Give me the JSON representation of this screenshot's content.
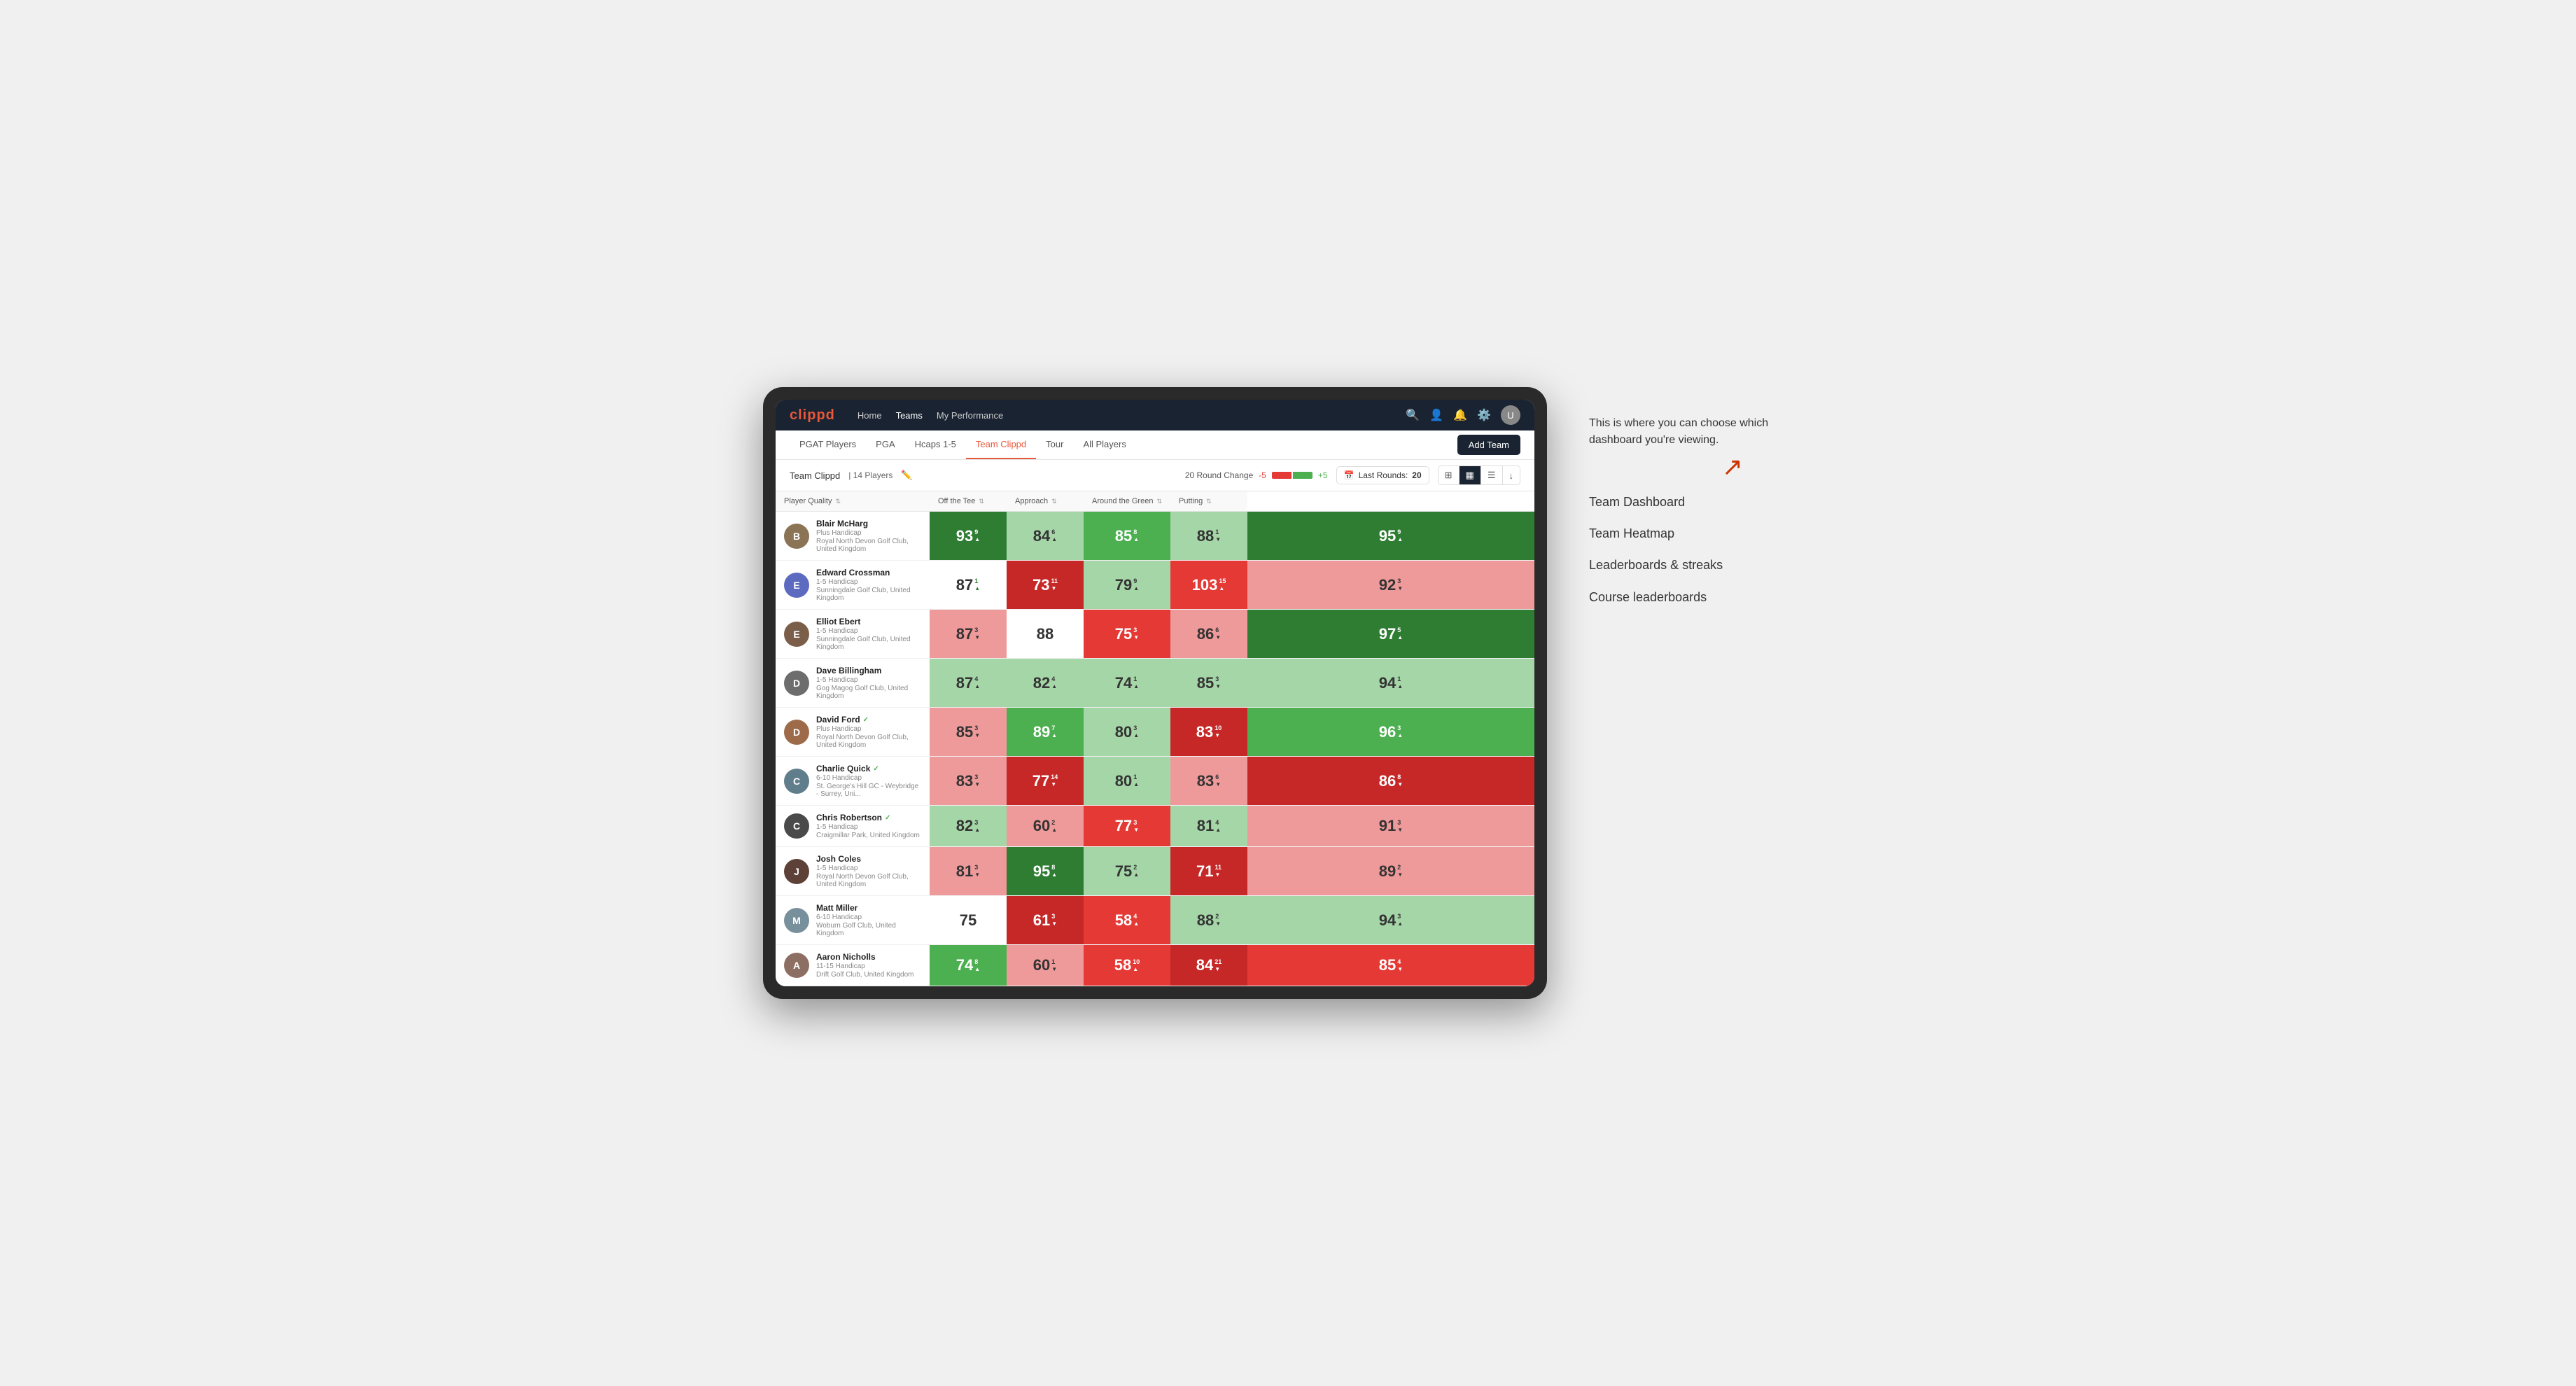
{
  "annotation": {
    "intro": "This is where you can choose which dashboard you're viewing.",
    "options": [
      "Team Dashboard",
      "Team Heatmap",
      "Leaderboards & streaks",
      "Course leaderboards"
    ]
  },
  "nav": {
    "logo": "clippd",
    "links": [
      "Home",
      "Teams",
      "My Performance"
    ],
    "active_link": "Teams"
  },
  "sub_nav": {
    "links": [
      "PGAT Players",
      "PGA",
      "Hcaps 1-5",
      "Team Clippd",
      "Tour",
      "All Players"
    ],
    "active_link": "Team Clippd",
    "add_team_label": "Add Team"
  },
  "team_bar": {
    "name": "Team Clippd",
    "separator": "|",
    "count": "14 Players",
    "round_change_label": "20 Round Change",
    "change_neg": "-5",
    "change_pos": "+5",
    "last_rounds_label": "Last Rounds:",
    "last_rounds_value": "20"
  },
  "table": {
    "columns": [
      {
        "key": "player",
        "label": "Player Quality"
      },
      {
        "key": "off_tee",
        "label": "Off the Tee"
      },
      {
        "key": "approach",
        "label": "Approach"
      },
      {
        "key": "around_green",
        "label": "Around the Green"
      },
      {
        "key": "putting",
        "label": "Putting"
      }
    ],
    "rows": [
      {
        "name": "Blair McHarg",
        "hcap": "Plus Handicap",
        "club": "Royal North Devon Golf Club, United Kingdom",
        "avatar_color": "#8B7355",
        "avatar_initial": "B",
        "scores": [
          {
            "val": 93,
            "change": "9",
            "dir": "up",
            "bg": "bg-green-strong"
          },
          {
            "val": 84,
            "change": "6",
            "dir": "up",
            "bg": "bg-green-light"
          },
          {
            "val": 85,
            "change": "8",
            "dir": "up",
            "bg": "bg-green-mid"
          },
          {
            "val": 88,
            "change": "1",
            "dir": "down",
            "bg": "bg-green-light"
          },
          {
            "val": 95,
            "change": "9",
            "dir": "up",
            "bg": "bg-green-strong"
          }
        ]
      },
      {
        "name": "Edward Crossman",
        "hcap": "1-5 Handicap",
        "club": "Sunningdale Golf Club, United Kingdom",
        "avatar_color": "#5c6bc0",
        "avatar_initial": "E",
        "scores": [
          {
            "val": 87,
            "change": "1",
            "dir": "up",
            "bg": "bg-white"
          },
          {
            "val": 73,
            "change": "11",
            "dir": "down",
            "bg": "bg-red-strong"
          },
          {
            "val": 79,
            "change": "9",
            "dir": "up",
            "bg": "bg-green-light"
          },
          {
            "val": 103,
            "change": "15",
            "dir": "up",
            "bg": "bg-red-mid"
          },
          {
            "val": 92,
            "change": "3",
            "dir": "down",
            "bg": "bg-red-light"
          }
        ]
      },
      {
        "name": "Elliot Ebert",
        "hcap": "1-5 Handicap",
        "club": "Sunningdale Golf Club, United Kingdom",
        "avatar_color": "#7b5e4a",
        "avatar_initial": "E",
        "scores": [
          {
            "val": 87,
            "change": "3",
            "dir": "down",
            "bg": "bg-red-light"
          },
          {
            "val": 88,
            "change": "",
            "dir": "",
            "bg": "bg-white"
          },
          {
            "val": 75,
            "change": "3",
            "dir": "down",
            "bg": "bg-red-mid"
          },
          {
            "val": 86,
            "change": "6",
            "dir": "down",
            "bg": "bg-red-light"
          },
          {
            "val": 97,
            "change": "5",
            "dir": "up",
            "bg": "bg-green-strong"
          }
        ]
      },
      {
        "name": "Dave Billingham",
        "hcap": "1-5 Handicap",
        "club": "Gog Magog Golf Club, United Kingdom",
        "avatar_color": "#6d6d6d",
        "avatar_initial": "D",
        "scores": [
          {
            "val": 87,
            "change": "4",
            "dir": "up",
            "bg": "bg-green-light"
          },
          {
            "val": 82,
            "change": "4",
            "dir": "up",
            "bg": "bg-green-light"
          },
          {
            "val": 74,
            "change": "1",
            "dir": "up",
            "bg": "bg-green-light"
          },
          {
            "val": 85,
            "change": "3",
            "dir": "down",
            "bg": "bg-green-light"
          },
          {
            "val": 94,
            "change": "1",
            "dir": "up",
            "bg": "bg-green-light"
          }
        ]
      },
      {
        "name": "David Ford",
        "hcap": "Plus Handicap",
        "club": "Royal North Devon Golf Club, United Kingdom",
        "avatar_color": "#9e6b4a",
        "avatar_initial": "D",
        "verified": true,
        "scores": [
          {
            "val": 85,
            "change": "3",
            "dir": "down",
            "bg": "bg-red-light"
          },
          {
            "val": 89,
            "change": "7",
            "dir": "up",
            "bg": "bg-green-mid"
          },
          {
            "val": 80,
            "change": "3",
            "dir": "up",
            "bg": "bg-green-light"
          },
          {
            "val": 83,
            "change": "10",
            "dir": "down",
            "bg": "bg-red-strong"
          },
          {
            "val": 96,
            "change": "3",
            "dir": "up",
            "bg": "bg-green-mid"
          }
        ]
      },
      {
        "name": "Charlie Quick",
        "hcap": "6-10 Handicap",
        "club": "St. George's Hill GC - Weybridge - Surrey, Uni...",
        "avatar_color": "#607d8b",
        "avatar_initial": "C",
        "verified": true,
        "scores": [
          {
            "val": 83,
            "change": "3",
            "dir": "down",
            "bg": "bg-red-light"
          },
          {
            "val": 77,
            "change": "14",
            "dir": "down",
            "bg": "bg-red-strong"
          },
          {
            "val": 80,
            "change": "1",
            "dir": "up",
            "bg": "bg-green-light"
          },
          {
            "val": 83,
            "change": "6",
            "dir": "down",
            "bg": "bg-red-light"
          },
          {
            "val": 86,
            "change": "8",
            "dir": "down",
            "bg": "bg-red-strong"
          }
        ]
      },
      {
        "name": "Chris Robertson",
        "hcap": "1-5 Handicap",
        "club": "Craigmillar Park, United Kingdom",
        "avatar_color": "#4a4a4a",
        "avatar_initial": "C",
        "verified": true,
        "scores": [
          {
            "val": 82,
            "change": "3",
            "dir": "up",
            "bg": "bg-green-light"
          },
          {
            "val": 60,
            "change": "2",
            "dir": "up",
            "bg": "bg-red-light"
          },
          {
            "val": 77,
            "change": "3",
            "dir": "down",
            "bg": "bg-red-mid"
          },
          {
            "val": 81,
            "change": "4",
            "dir": "up",
            "bg": "bg-green-light"
          },
          {
            "val": 91,
            "change": "3",
            "dir": "down",
            "bg": "bg-red-light"
          }
        ]
      },
      {
        "name": "Josh Coles",
        "hcap": "1-5 Handicap",
        "club": "Royal North Devon Golf Club, United Kingdom",
        "avatar_color": "#5d4037",
        "avatar_initial": "J",
        "scores": [
          {
            "val": 81,
            "change": "3",
            "dir": "down",
            "bg": "bg-red-light"
          },
          {
            "val": 95,
            "change": "8",
            "dir": "up",
            "bg": "bg-green-strong"
          },
          {
            "val": 75,
            "change": "2",
            "dir": "up",
            "bg": "bg-green-light"
          },
          {
            "val": 71,
            "change": "11",
            "dir": "down",
            "bg": "bg-red-strong"
          },
          {
            "val": 89,
            "change": "2",
            "dir": "down",
            "bg": "bg-red-light"
          }
        ]
      },
      {
        "name": "Matt Miller",
        "hcap": "6-10 Handicap",
        "club": "Woburn Golf Club, United Kingdom",
        "avatar_color": "#78909c",
        "avatar_initial": "M",
        "scores": [
          {
            "val": 75,
            "change": "",
            "dir": "",
            "bg": "bg-white"
          },
          {
            "val": 61,
            "change": "3",
            "dir": "down",
            "bg": "bg-red-strong"
          },
          {
            "val": 58,
            "change": "4",
            "dir": "up",
            "bg": "bg-red-mid"
          },
          {
            "val": 88,
            "change": "2",
            "dir": "down",
            "bg": "bg-green-light"
          },
          {
            "val": 94,
            "change": "3",
            "dir": "up",
            "bg": "bg-green-light"
          }
        ]
      },
      {
        "name": "Aaron Nicholls",
        "hcap": "11-15 Handicap",
        "club": "Drift Golf Club, United Kingdom",
        "avatar_color": "#8d6e63",
        "avatar_initial": "A",
        "scores": [
          {
            "val": 74,
            "change": "8",
            "dir": "up",
            "bg": "bg-green-mid"
          },
          {
            "val": 60,
            "change": "1",
            "dir": "down",
            "bg": "bg-red-light"
          },
          {
            "val": 58,
            "change": "10",
            "dir": "up",
            "bg": "bg-red-mid"
          },
          {
            "val": 84,
            "change": "21",
            "dir": "down",
            "bg": "bg-red-strong"
          },
          {
            "val": 85,
            "change": "4",
            "dir": "down",
            "bg": "bg-red-mid"
          }
        ]
      }
    ]
  }
}
